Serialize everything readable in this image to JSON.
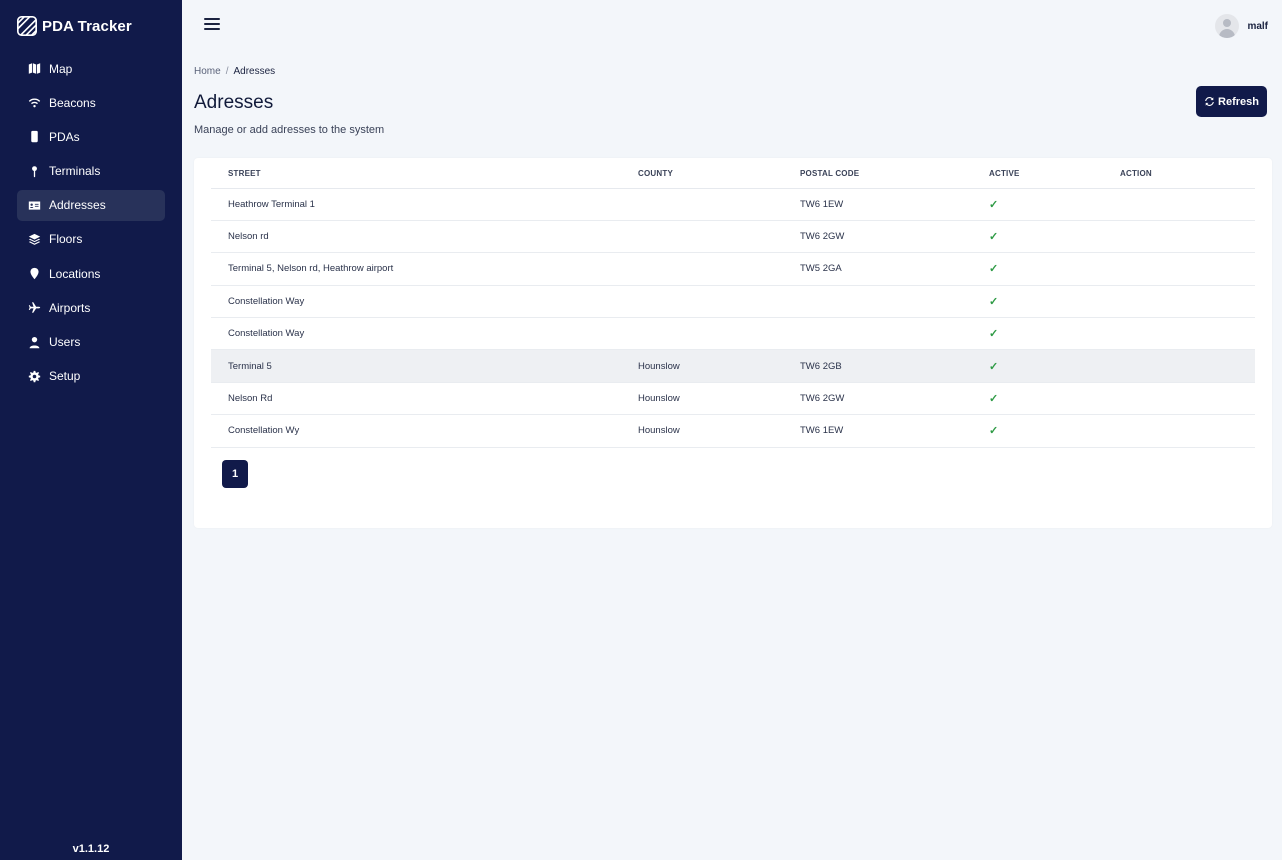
{
  "app": {
    "title": "PDA Tracker",
    "version": "v1.1.12",
    "user": "malf",
    "accent": "#111a4a",
    "background": "#f3f6fa",
    "check_color": "#2e9a45"
  },
  "sidebar": {
    "items": [
      {
        "label": "Map",
        "icon": "map-icon"
      },
      {
        "label": "Beacons",
        "icon": "wifi-icon"
      },
      {
        "label": "PDAs",
        "icon": "mobile-icon"
      },
      {
        "label": "Terminals",
        "icon": "pin-icon"
      },
      {
        "label": "Addresses",
        "icon": "address-card-icon",
        "active": true
      },
      {
        "label": "Floors",
        "icon": "layers-icon"
      },
      {
        "label": "Locations",
        "icon": "location-marker-icon"
      },
      {
        "label": "Airports",
        "icon": "plane-icon"
      },
      {
        "label": "Users",
        "icon": "user-icon"
      },
      {
        "label": "Setup",
        "icon": "gear-icon"
      }
    ]
  },
  "breadcrumb": {
    "home": "Home",
    "separator": "/",
    "current": "Adresses"
  },
  "page": {
    "title": "Adresses",
    "subtitle": "Manage or add adresses to the system",
    "refresh_label": "Refresh"
  },
  "table": {
    "headers": {
      "street": "STREET",
      "county": "COUNTY",
      "postal": "POSTAL CODE",
      "active": "ACTIVE",
      "action": "ACTION"
    },
    "rows": [
      {
        "street": "Heathrow Terminal 1",
        "county": "",
        "postal": "TW6 1EW",
        "active": "✓"
      },
      {
        "street": "Nelson rd",
        "county": "",
        "postal": "TW6 2GW",
        "active": "✓"
      },
      {
        "street": "Terminal 5, Nelson rd, Heathrow airport",
        "county": "",
        "postal": "TW5 2GA",
        "active": "✓"
      },
      {
        "street": "Constellation Way",
        "county": "",
        "postal": "",
        "active": "✓"
      },
      {
        "street": "Constellation Way",
        "county": "",
        "postal": "",
        "active": "✓"
      },
      {
        "street": "Terminal 5",
        "county": "Hounslow",
        "postal": "TW6 2GB",
        "active": "✓"
      },
      {
        "street": "Nelson Rd",
        "county": "Hounslow",
        "postal": "TW6 2GW",
        "active": "✓"
      },
      {
        "street": "Constellation Wy",
        "county": "Hounslow",
        "postal": "TW6 1EW",
        "active": "✓"
      }
    ]
  },
  "pagination": {
    "current": "1"
  }
}
